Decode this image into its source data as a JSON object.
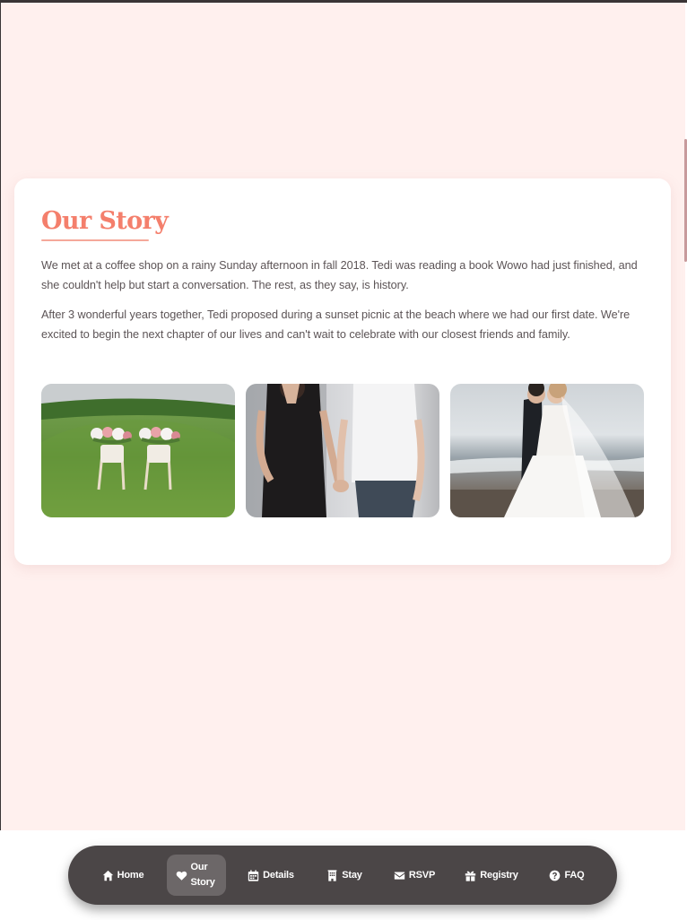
{
  "story": {
    "title": "Our Story",
    "paragraphs": [
      "We met at a coffee shop on a rainy Sunday afternoon in fall 2018. Tedi was reading a book Wowo had just finished, and she couldn't help but start a conversation. The rest, as they say, is history.",
      "After 3 wonderful years together, Tedi proposed during a sunset picnic at the beach where we had our first date. We're excited to begin the next chapter of our lives and can't wait to celebrate with our closest friends and family."
    ]
  },
  "nav": {
    "items": [
      {
        "label": "Home",
        "icon": "home-icon",
        "active": false
      },
      {
        "label": "Our Story",
        "icon": "heart-icon",
        "active": true
      },
      {
        "label": "Details",
        "icon": "calendar-icon",
        "active": false
      },
      {
        "label": "Stay",
        "icon": "hotel-icon",
        "active": false
      },
      {
        "label": "RSVP",
        "icon": "envelope-icon",
        "active": false
      },
      {
        "label": "Registry",
        "icon": "gift-icon",
        "active": false
      },
      {
        "label": "FAQ",
        "icon": "question-circle-icon",
        "active": false
      }
    ]
  },
  "colors": {
    "accent": "#f47f6c",
    "page_background": "#fff0ee",
    "nav_background": "#4b4647"
  }
}
